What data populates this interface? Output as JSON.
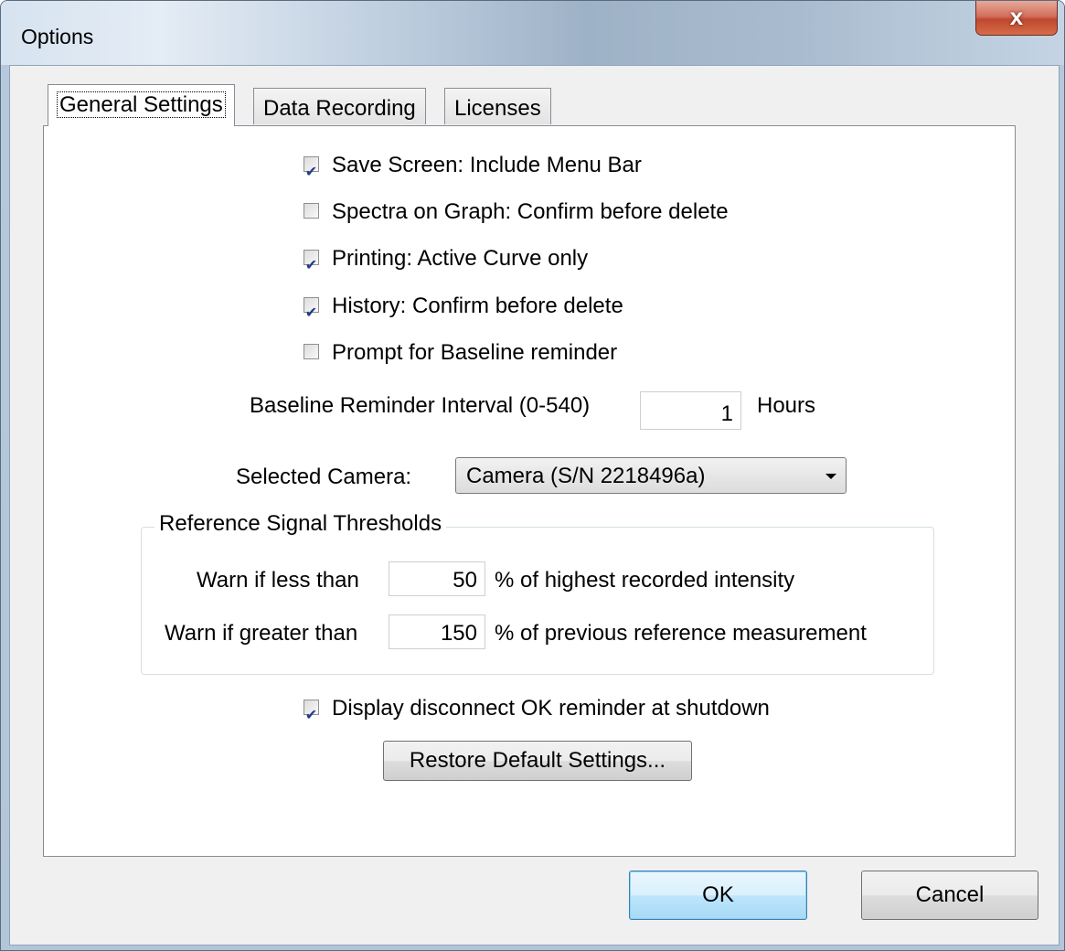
{
  "window": {
    "title": "Options",
    "close_label": "x"
  },
  "tabs": [
    {
      "label": "General Settings",
      "active": true
    },
    {
      "label": "Data Recording",
      "active": false
    },
    {
      "label": "Licenses",
      "active": false
    }
  ],
  "general": {
    "checkboxes": [
      {
        "label": "Save Screen: Include Menu Bar",
        "checked": true
      },
      {
        "label": "Spectra on Graph: Confirm before delete",
        "checked": false
      },
      {
        "label": "Printing: Active Curve only",
        "checked": true
      },
      {
        "label": "History: Confirm before delete",
        "checked": true
      },
      {
        "label": "Prompt for Baseline reminder",
        "checked": false
      }
    ],
    "baseline_interval": {
      "label": "Baseline Reminder Interval (0-540)",
      "value": "1",
      "unit": "Hours"
    },
    "camera": {
      "label": "Selected Camera:",
      "selected": "Camera (S/N 2218496a)"
    },
    "thresholds": {
      "title": "Reference Signal Thresholds",
      "less": {
        "label": "Warn if less than",
        "value": "50",
        "suffix": "% of highest recorded intensity"
      },
      "greater": {
        "label": "Warn if greater than",
        "value": "150",
        "suffix": "% of previous reference measurement"
      }
    },
    "disconnect": {
      "label": "Display disconnect OK reminder at shutdown",
      "checked": true
    },
    "restore_label": "Restore Default Settings..."
  },
  "buttons": {
    "ok": "OK",
    "cancel": "Cancel"
  },
  "colors": {
    "check": "#213b88",
    "default_button_border": "#3c7fb1",
    "close_button": "#c0482f"
  },
  "icons": {
    "close": "close-icon",
    "dropdown": "chevron-down-icon",
    "check": "check-icon"
  }
}
